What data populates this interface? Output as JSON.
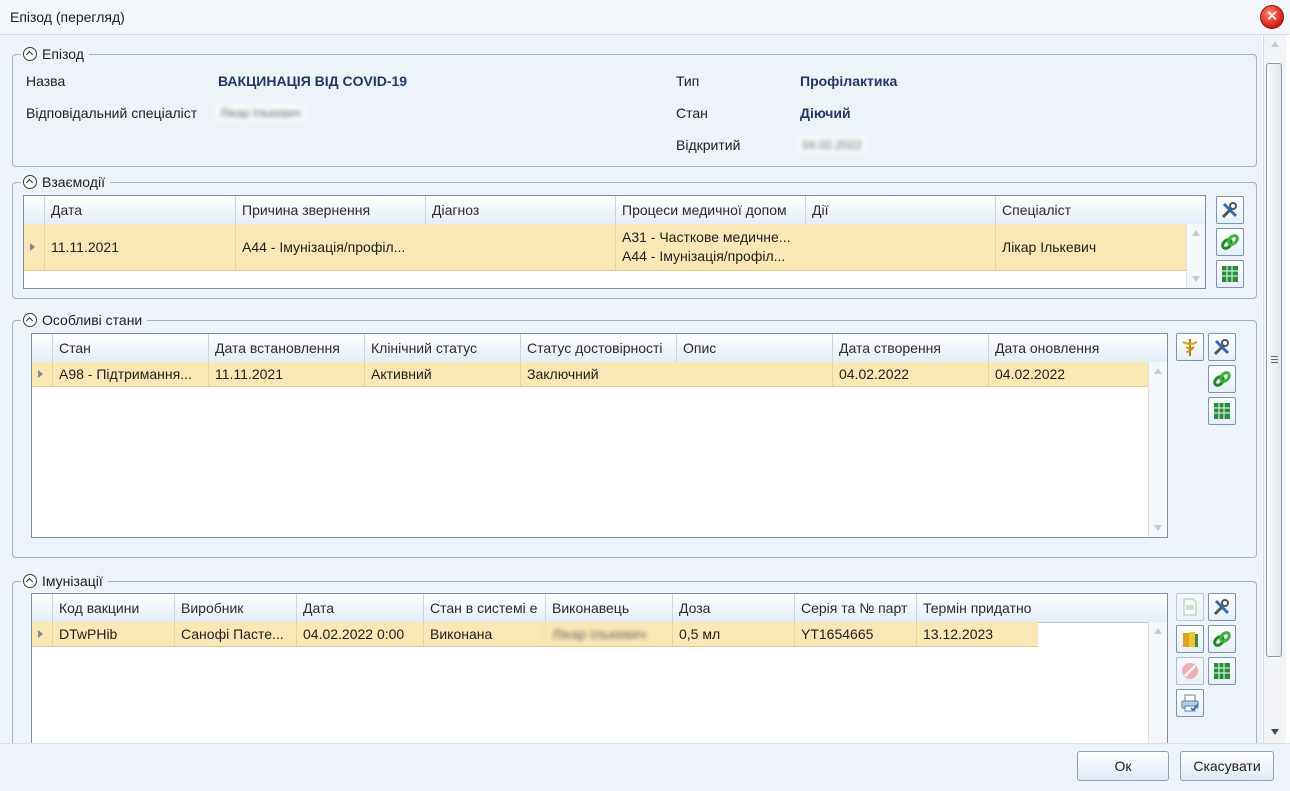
{
  "window": {
    "title": "Епізод (перегляд)"
  },
  "episode": {
    "legend": "Епізод",
    "name_label": "Назва",
    "name_value": "ВАКЦИНАЦІЯ ВІД COVID-19",
    "specialist_label": "Відповідальний спеціаліст",
    "specialist_value": "Лікар Ількевич",
    "type_label": "Тип",
    "type_value": "Профілактика",
    "state_label": "Стан",
    "state_value": "Діючий",
    "opened_label": "Відкритий",
    "opened_value": "04.02.2022"
  },
  "interactions": {
    "legend": "Взаємодії",
    "columns": [
      "Дата",
      "Причина звернення",
      "Діагноз",
      "Процеси медичної допом",
      "Дії",
      "Спеціаліст"
    ],
    "rows": [
      {
        "date": "11.11.2021",
        "reason": "A44 - Імунізація/профіл...",
        "diagnosis": "",
        "process1": "A31 - Часткове медичне...",
        "process2": "A44 - Імунізація/профіл...",
        "actions": "",
        "specialist": "Лікар  Ількевич"
      }
    ]
  },
  "conditions": {
    "legend": "Особливі стани",
    "columns": [
      "Стан",
      "Дата встановлення",
      "Клінічний статус",
      "Статус достовірності",
      "Опис",
      "Дата створення",
      "Дата оновлення"
    ],
    "rows": [
      {
        "state": "A98 - Підтримання...",
        "established": "11.11.2021",
        "clinical": "Активний",
        "verification": "Заключний",
        "description": "",
        "created": "04.02.2022",
        "updated": "04.02.2022"
      }
    ]
  },
  "immunizations": {
    "legend": "Імунізації",
    "columns": [
      "Код вакцини",
      "Виробник",
      "Дата",
      "Стан в системі е",
      "Виконавець",
      "Доза",
      "Серія та № парт",
      "Термін придатно"
    ],
    "rows": [
      {
        "code": "DTwPHib",
        "manufacturer": "Санофі Пасте...",
        "date": "04.02.2022 0:00",
        "status": "Виконана",
        "performer": "Лікар Ількевич",
        "dose": "0,5 мл",
        "batch": "YT1654665",
        "expiry": "13.12.2023"
      }
    ]
  },
  "toolbar_icons": {
    "edit": "tools-icon",
    "link": "link-icon",
    "export": "excel-export-icon",
    "caduceus": "caduceus-icon",
    "new_doc": "new-document-icon",
    "book": "book-icon",
    "cancel": "cancel-icon",
    "print": "print-icon"
  },
  "footer": {
    "ok_label": "Ок",
    "cancel_label": "Скасувати"
  },
  "colors": {
    "selected_row": "#fbe7b5",
    "value_text": "#1f3864",
    "panel_bg": "#eef3fa"
  }
}
